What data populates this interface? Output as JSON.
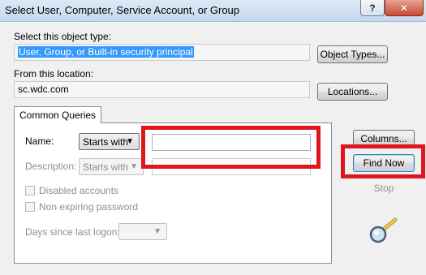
{
  "window": {
    "title": "Select User, Computer, Service Account, or Group",
    "help_glyph": "?",
    "close_glyph": "✕"
  },
  "object_type": {
    "label": "Select this object type:",
    "value": "User, Group, or Built-in security principal",
    "button": "Object Types..."
  },
  "location": {
    "label": "From this location:",
    "value": "sc.wdc.com",
    "button": "Locations..."
  },
  "queries": {
    "tab_label": "Common Queries",
    "name": {
      "label": "Name:",
      "mode": "Starts with",
      "value": ""
    },
    "description": {
      "label": "Description:",
      "mode": "Starts with",
      "value": ""
    },
    "disabled_accounts": "Disabled accounts",
    "non_expiring_password": "Non expiring password",
    "days_since_last_logon": {
      "label": "Days since last logon:",
      "value": ""
    }
  },
  "side_buttons": {
    "columns": "Columns...",
    "find_now": "Find Now",
    "stop": "Stop"
  },
  "icons": {
    "dropdown": "▼",
    "search": "magnifier-icon"
  },
  "highlight_color": "#e0161e"
}
